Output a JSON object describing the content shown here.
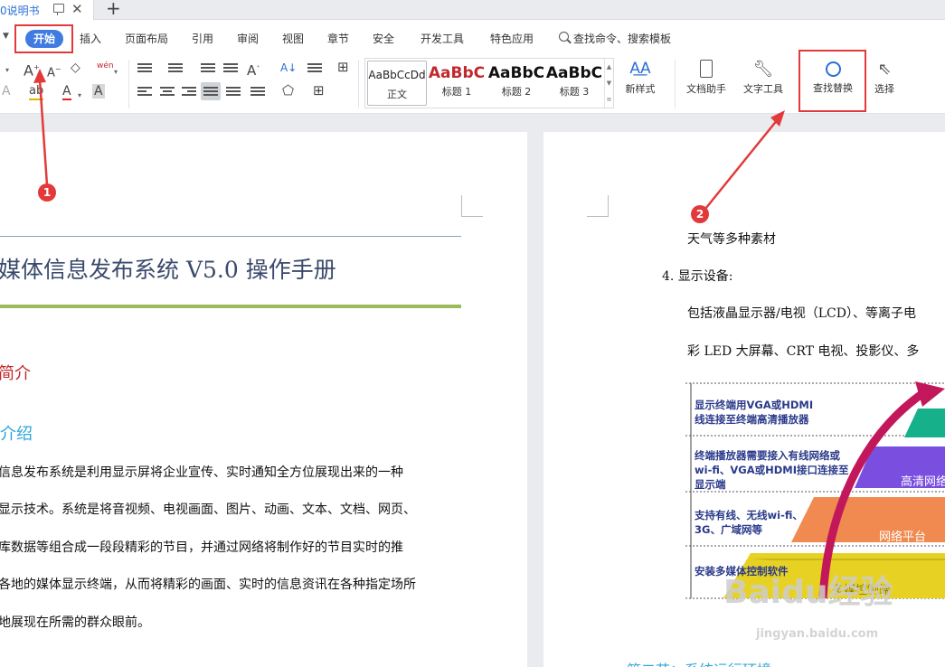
{
  "window": {
    "doc_tab_title": "0说明书",
    "new_tab": "+",
    "close": "✕"
  },
  "menu": {
    "active": "开始",
    "items": [
      "插入",
      "页面布局",
      "引用",
      "审阅",
      "视图",
      "章节",
      "安全",
      "开发工具",
      "特色应用"
    ],
    "search": "查找命令、搜索模板"
  },
  "ribbon": {
    "font_grow": "A",
    "font_shrink": "A",
    "pinyin": "wén",
    "font_color": "A",
    "char_shade": "A",
    "sort": "A↓",
    "styles": [
      {
        "preview": "AaBbCcDd",
        "label": "正文"
      },
      {
        "preview": "AaBbC",
        "label": "标题 1"
      },
      {
        "preview": "AaBbC",
        "label": "标题 2"
      },
      {
        "preview": "AaBbC",
        "label": "标题 3"
      }
    ],
    "new_style": "新样式",
    "doc_assistant": "文档助手",
    "text_tools": "文字工具",
    "find_replace": "查找替换",
    "select": "选择",
    "colors": {
      "accent": "#3f7be0",
      "highlight": "#e23a3a"
    }
  },
  "left_page": {
    "title": "媒体信息发布系统 V5.0 操作手册",
    "h1": "简介",
    "h2": "介绍",
    "paragraph_lines": [
      "信息发布系统是利用显示屏将企业宣传、实时通知全方位展现出来的一种",
      "显示技术。系统是将音视频、电视画面、图片、动画、文本、文档、网页、",
      "库数据等组合成一段段精彩的节目，并通过网络将制作好的节目实时的推",
      "各地的媒体显示终端，从而将精彩的画面、实时的信息资讯在各种指定场所",
      "地展现在所需的群众眼前。"
    ]
  },
  "right_page": {
    "line1": "天气等多种素材",
    "item4": "4.  显示设备:",
    "line2": "包括液晶显示器/电视（LCD）、等离子电",
    "line3": "彩 LED 大屏幕、CRT 电视、投影仪、多",
    "footer_heading": "第二节：系统运行环境",
    "diagram": {
      "labels": [
        "显示终端用VGA或HDMI",
        "线连接至终端高清播放器",
        "终端播放器需要接入有线网络或",
        "wi-fi、VGA或HDMI接口连接至",
        "显示端",
        "支持有线、无线wi-fi、",
        "3G、广域网等",
        "安装多媒体控制软件"
      ],
      "tiers": [
        "高清网络",
        "网络平台",
        "多媒控制端"
      ]
    }
  },
  "annotations": {
    "badge1": "1",
    "badge2": "2"
  },
  "watermark": {
    "brand": "Baidu经验",
    "url": "jingyan.baidu.com"
  }
}
